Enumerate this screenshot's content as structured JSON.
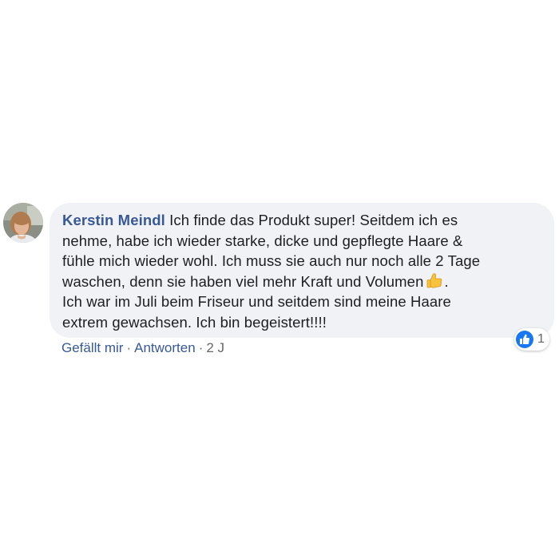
{
  "comment": {
    "author": "Kerstin Meindl",
    "lines": [
      "Ich finde das Produkt super! Seitdem ich es",
      "nehme, habe ich wieder starke, dicke und gepflegte Haare &",
      "fühle mich wieder wohl. Ich muss sie auch nur noch alle 2 Tage",
      "waschen, denn sie haben viel mehr Kraft und Volumen",
      ".",
      "Ich war im Juli beim Friseur und seitdem sind meine Haare",
      "extrem gewachsen. Ich bin begeistert!!!!"
    ],
    "emoji": "thumbs-up-emoji"
  },
  "reactions": {
    "icon": "like-icon",
    "count": "1"
  },
  "actions": {
    "like_label": "Gefällt mir",
    "reply_label": "Antworten",
    "separator": "·",
    "time": "2 J"
  },
  "colors": {
    "bubble_bg": "#f0f2f5",
    "link": "#385898",
    "text": "#1c1e21",
    "meta": "#65676b",
    "like_blue": "#1877f2"
  }
}
